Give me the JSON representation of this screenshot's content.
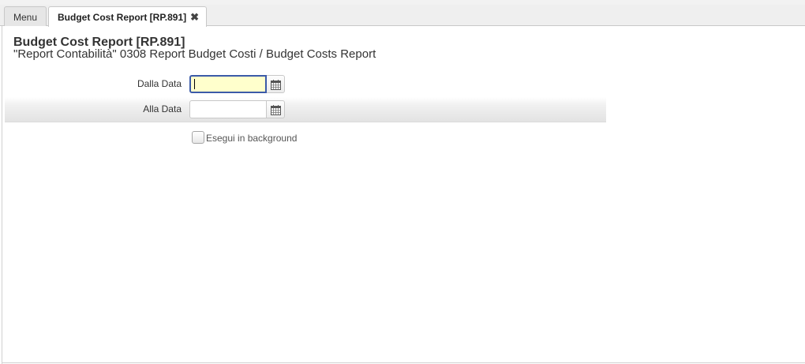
{
  "tabs": {
    "menu_label": "Menu",
    "active_label": "Budget Cost Report [RP.891]",
    "close_glyph": "✖"
  },
  "header": {
    "title": "Budget Cost Report [RP.891]",
    "subtitle": "\"Report Contabilità\" 0308 Report Budget Costi / Budget Costs Report"
  },
  "form": {
    "from_date": {
      "label": "Dalla Data",
      "value": "",
      "icon": "calendar-icon"
    },
    "to_date": {
      "label": "Alla Data",
      "value": "",
      "icon": "calendar-icon"
    },
    "background": {
      "label": "Esegui in background",
      "checked": false
    }
  },
  "colors": {
    "focused_field_bg": "#ffffcc",
    "focused_field_border": "#3b5aa8"
  }
}
